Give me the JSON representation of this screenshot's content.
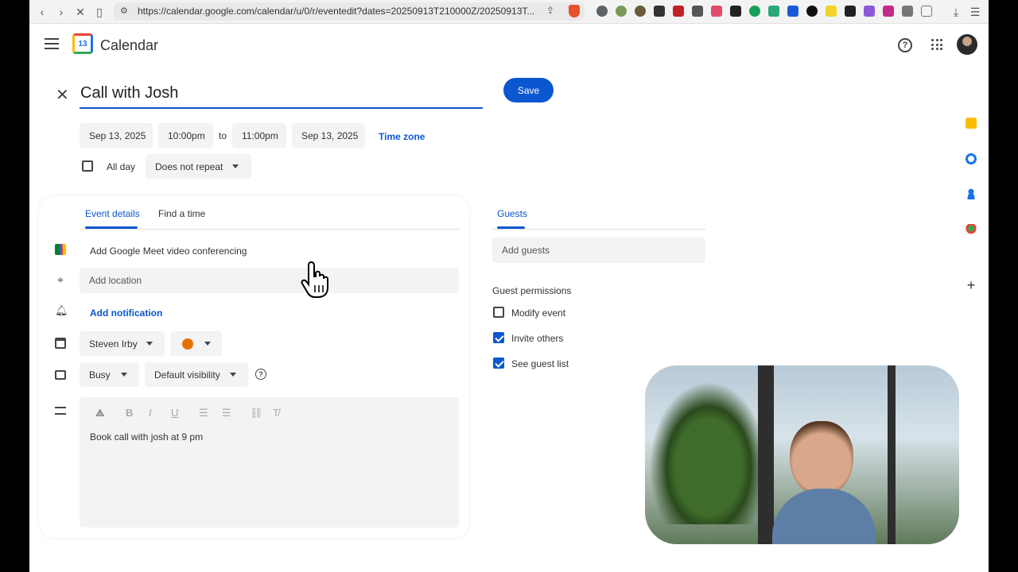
{
  "browser": {
    "url": "https://calendar.google.com/calendar/u/0/r/eventedit?dates=20250913T210000Z/20250913T..."
  },
  "app": {
    "title": "Calendar",
    "logo_day": "13"
  },
  "event": {
    "title": "Call with Josh",
    "save_label": "Save",
    "start_date": "Sep 13, 2025",
    "start_time": "10:00pm",
    "to_label": "to",
    "end_time": "11:00pm",
    "end_date": "Sep 13, 2025",
    "timezone_label": "Time zone",
    "allday_label": "All day",
    "repeat_value": "Does not repeat"
  },
  "details": {
    "tabs": [
      {
        "label": "Event details",
        "active": true
      },
      {
        "label": "Find a time",
        "active": false
      }
    ],
    "meet_label": "Add Google Meet video conferencing",
    "location_placeholder": "Add location",
    "notification_label": "Add notification",
    "calendar_owner": "Steven Irby",
    "event_color": "#e37400",
    "availability": "Busy",
    "visibility": "Default visibility",
    "description": "Book call with josh at 9 pm"
  },
  "guests": {
    "tab_label": "Guests",
    "add_placeholder": "Add guests",
    "permissions_title": "Guest permissions",
    "permissions": [
      {
        "label": "Modify event",
        "checked": false
      },
      {
        "label": "Invite others",
        "checked": true
      },
      {
        "label": "See guest list",
        "checked": true
      }
    ]
  },
  "colors": {
    "accent": "#0b57d0",
    "field_bg": "#f1f3f4"
  }
}
